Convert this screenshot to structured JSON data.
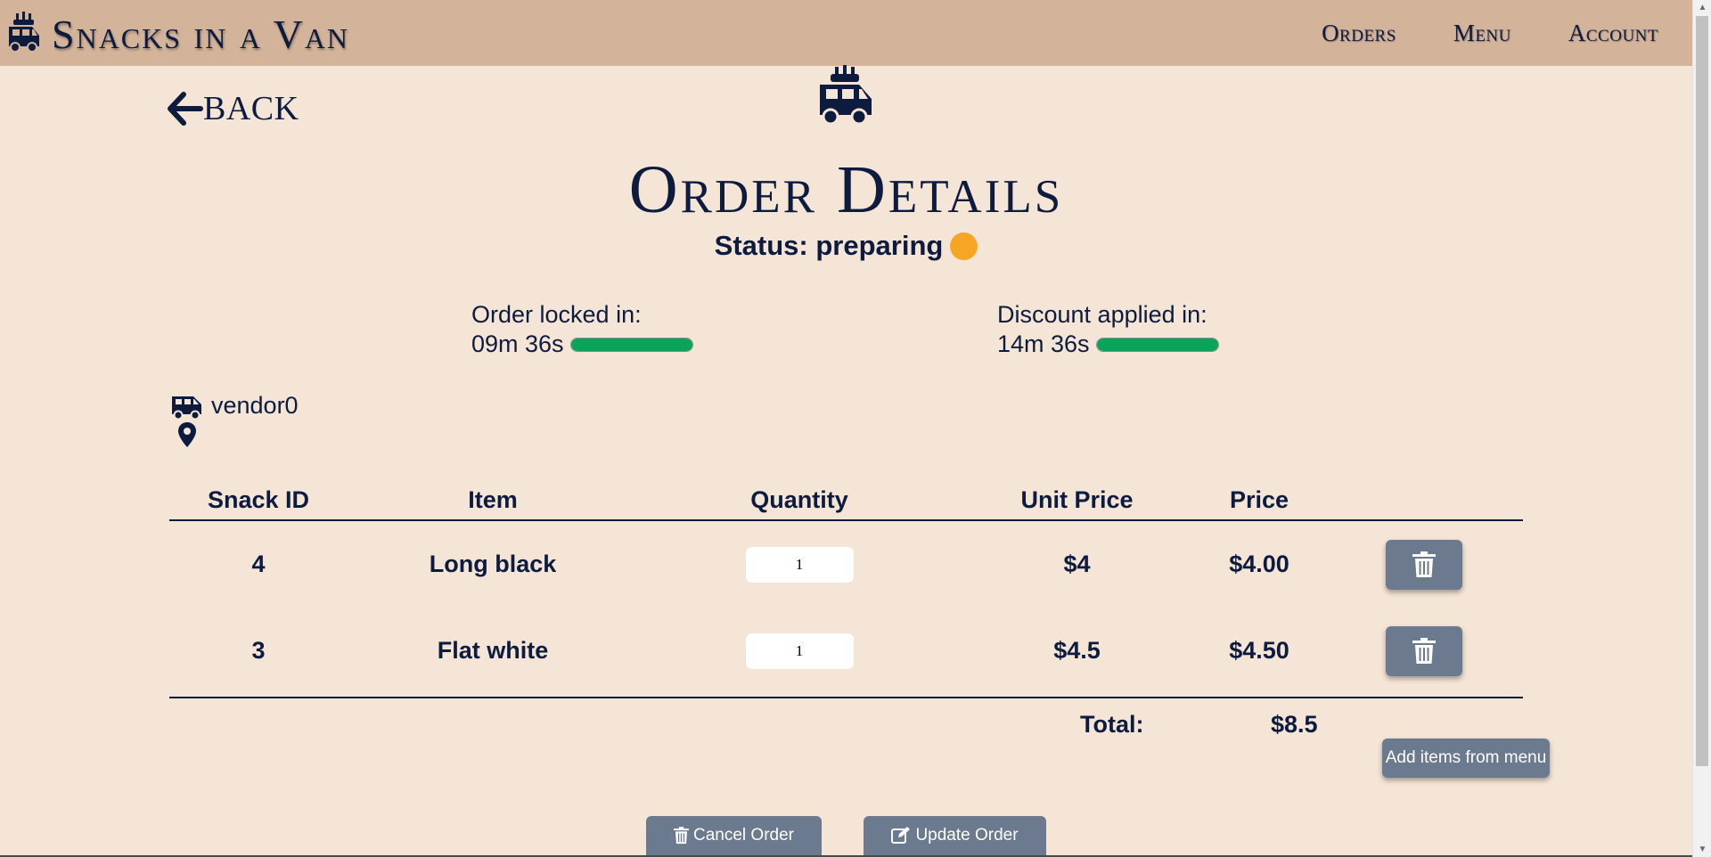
{
  "colors": {
    "navbar": "#d3b399",
    "page_bg": "#f5e5d7",
    "text": "#0d1b3e",
    "button": "#6b7a8f",
    "status_dot": "#f5a623",
    "progress": "#0aa35a"
  },
  "navbar": {
    "brand_icon": "food-truck-icon",
    "brand": "Snacks in a Van",
    "links": [
      "Orders",
      "Menu",
      "Account"
    ]
  },
  "page": {
    "back_icon": "arrow-left-icon",
    "back_label": "BACK",
    "hero_icon": "food-truck-icon",
    "title": "Order Details",
    "status": "Status: preparing"
  },
  "timers": {
    "lock": {
      "label": "Order locked in:",
      "time": "09m 36s",
      "progress": 1.0
    },
    "discount": {
      "label": "Discount applied in:",
      "time": "14m 36s",
      "progress": 1.0
    }
  },
  "vendor": {
    "van_icon": "van-icon",
    "name": "vendor0",
    "location_icon": "map-pin-icon"
  },
  "table": {
    "headers": [
      "Snack ID",
      "Item",
      "Quantity",
      "Unit Price",
      "Price"
    ],
    "rows": [
      {
        "id": "4",
        "item": "Long black",
        "quantity": "1",
        "unit_price": "$4",
        "price": "$4.00",
        "action_icon": "trash-icon"
      },
      {
        "id": "3",
        "item": "Flat white",
        "quantity": "1",
        "unit_price": "$4.5",
        "price": "$4.50",
        "action_icon": "trash-icon"
      }
    ],
    "total_label": "Total:",
    "total_value": "$8.5"
  },
  "actions": {
    "add_items": "Add items from menu",
    "cancel": "Cancel Order",
    "cancel_icon": "trash-icon",
    "update": "Update Order",
    "update_icon": "edit-icon"
  }
}
